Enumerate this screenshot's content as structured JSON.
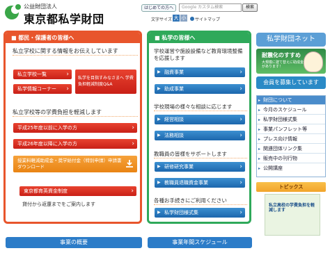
{
  "header": {
    "org_type": "公益財団法人",
    "org_name": "東京都私学財団",
    "beginner_label": "はじめての方へ",
    "search_placeholder": "Google カスタム検索",
    "search_button": "検索",
    "font_size_label": "文字サイズ",
    "font_large": "大",
    "font_small": "小",
    "sitemap_label": "サイトマップ"
  },
  "left": {
    "heading": "都民・保護者の皆様へ",
    "section1_title": "私立学校に関する情報をお伝えしています",
    "btn_school_list": "私立学校一覧",
    "btn_info_corner": "私学情報コーナー",
    "btn_qa": "私学を目指すみなさまへ 学費負担軽減制度Q&A",
    "section2_title": "私立学校等の学費負担を軽減します",
    "btn_h25": "平成25年度以前に入学の方",
    "btn_h26": "平成26年度以降に入学の方",
    "btn_download": "授業料軽減助成金・奨学給付金（特別申請）申請書ダウンロード",
    "btn_scholarship": "東京都育英資金制度",
    "scholarship_note": "貸付から返還までをご案内します"
  },
  "middle": {
    "heading": "私学の皆様へ",
    "section1_title": "学校運営や施設設備など教育環境整備を応援します",
    "btn_loan": "融資事業",
    "btn_grant": "助成事業",
    "section2_title": "学校現場の様々な相談に応じます",
    "btn_consult_mgmt": "経営相談",
    "btn_consult_law": "法務相談",
    "section3_title": "教職員の皆様をサポートします",
    "btn_training": "研修研究事業",
    "btn_retirement": "教職員退職資金事業",
    "section4_title": "各種お手続きにご利用ください",
    "btn_forms": "私学財団様式集"
  },
  "right": {
    "net_heading": "私学財団ネット",
    "quake_title": "耐震化のすすめ",
    "quake_sub": "大規模に建て替えに助成金があります！",
    "member_label": "会員を募集しています",
    "nav_heading": "財団について",
    "nav_items": [
      "今月のスケジュール",
      "私学財団様式集",
      "事業パンフレット等",
      "プレス向け情報",
      "関連団体リンク集",
      "販売中の刊行物",
      "公開講座"
    ],
    "topics_label": "トピックス",
    "topics_text": "私立高校の学費負担を軽減します"
  },
  "footer": {
    "btn_overview": "事業の概要",
    "btn_schedule": "事業年間スケジュール"
  },
  "colors": {
    "accent_orange": "#e8552c",
    "accent_green": "#2fa95a",
    "button_red": "#d52a1c",
    "button_blue": "#2a7cc0"
  }
}
